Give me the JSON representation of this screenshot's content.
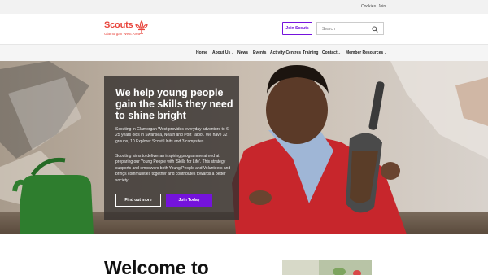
{
  "utility_bar": {
    "cookies": "Cookies",
    "join": "Join"
  },
  "brand": {
    "title": "Scouts",
    "subtitle": "Glamorgan West Area",
    "color": "#e8453c"
  },
  "header": {
    "join_button": "Join Scouts",
    "search_placeholder": "Search",
    "accent": "#7413dc"
  },
  "nav": {
    "items": [
      {
        "label": "Home"
      },
      {
        "label": "About Us",
        "dropdown": true
      },
      {
        "label": "News"
      },
      {
        "label": "Events"
      },
      {
        "label": "Activity Centres"
      },
      {
        "label": "Training"
      },
      {
        "label": "Contact",
        "dropdown": true
      },
      {
        "label": "Member Resources",
        "dropdown": true
      }
    ]
  },
  "hero": {
    "heading": "We help young people gain the skills they need to shine bright",
    "paragraph1": "Scouting in Glamorgan West provides everyday adventure to 6-25 years olds in Swansea, Neath and Port Talbot. We have 32 groups, 10 Explorer Scout Units and 3 campsites.",
    "paragraph2": "Scouting aims to deliver an inspiring programme aimed at preparing our Young People with 'Skills for Life'. This strategy supports and empowers both Young People and Volunteers and brings communities together and contributes towards a better society.",
    "find_out_more": "Find out more",
    "join_today": "Join Today"
  },
  "welcome": {
    "heading": "Welcome to"
  },
  "icons": {
    "search": "search-icon",
    "chevron": "chevron-down-icon",
    "emblem": "fleur-de-lis-icon"
  }
}
